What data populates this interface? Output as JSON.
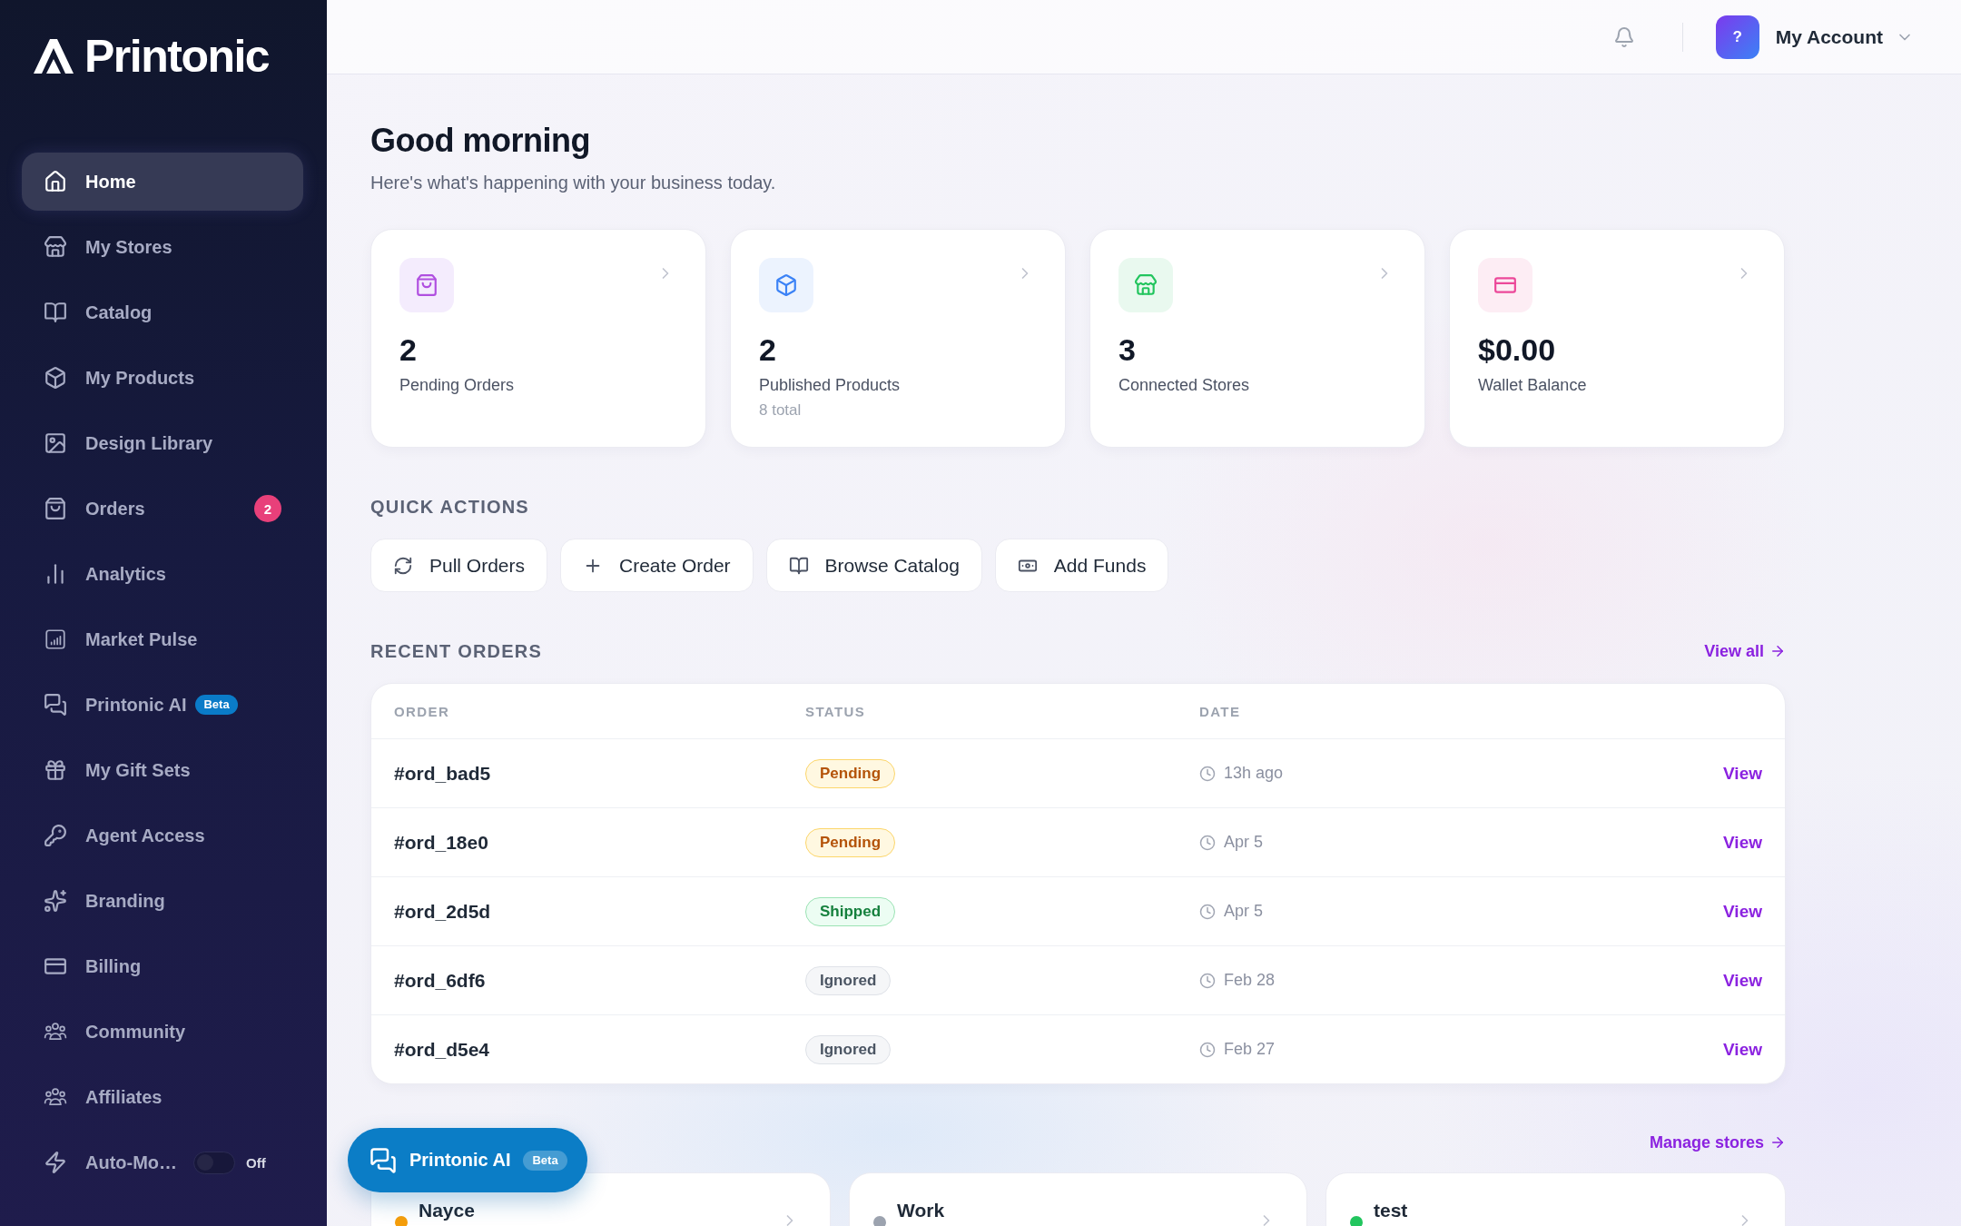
{
  "sidebar": {
    "logo": "Printonic",
    "items": [
      {
        "label": "Home",
        "selected": true
      },
      {
        "label": "My Stores",
        "selected": false
      },
      {
        "label": "Catalog",
        "selected": false
      },
      {
        "label": "My Products",
        "selected": false
      },
      {
        "label": "Design Library",
        "selected": false
      },
      {
        "label": "Orders",
        "selected": false,
        "badge": "2"
      },
      {
        "label": "Analytics",
        "selected": false
      },
      {
        "label": "Market Pulse",
        "selected": false
      },
      {
        "label": "Printonic AI",
        "selected": false,
        "tag": "Beta"
      },
      {
        "label": "My Gift Sets",
        "selected": false
      },
      {
        "label": "Agent Access",
        "selected": false
      },
      {
        "label": "Branding",
        "selected": false
      },
      {
        "label": "Billing",
        "selected": false
      },
      {
        "label": "Community",
        "selected": false
      },
      {
        "label": "Affiliates",
        "selected": false
      },
      {
        "label": "Auto-Mo…",
        "selected": false,
        "toggle": {
          "on": false,
          "label": "Off"
        }
      }
    ]
  },
  "top_bar": {
    "account": {
      "avatar": "?",
      "label": "My Account"
    }
  },
  "greeting": {
    "title": "Good morning",
    "subtitle": "Here's what's happening with your business today."
  },
  "stats": [
    {
      "value": "2",
      "label": "Pending Orders"
    },
    {
      "value": "2",
      "label": "Published Products",
      "note": "8 total"
    },
    {
      "value": "3",
      "label": "Connected Stores"
    },
    {
      "value": "$0.00",
      "label": "Wallet Balance"
    }
  ],
  "quick_actions": {
    "title": "QUICK ACTIONS",
    "buttons": [
      "Pull Orders",
      "Create Order",
      "Browse Catalog",
      "Add Funds"
    ]
  },
  "recent_orders": {
    "title": "RECENT ORDERS",
    "link": "View all",
    "columns": [
      "ORDER",
      "STATUS",
      "DATE"
    ],
    "rows": [
      {
        "order": "#ord_bad5",
        "status": {
          "label": "Pending",
          "kind": "pending"
        },
        "date": "13h ago",
        "action": "View"
      },
      {
        "order": "#ord_18e0",
        "status": {
          "label": "Pending",
          "kind": "pending"
        },
        "date": "Apr 5",
        "action": "View"
      },
      {
        "order": "#ord_2d5d",
        "status": {
          "label": "Shipped",
          "kind": "shipped"
        },
        "date": "Apr 5",
        "action": "View"
      },
      {
        "order": "#ord_6df6",
        "status": {
          "label": "Ignored",
          "kind": "ignored"
        },
        "date": "Feb 28",
        "action": "View"
      },
      {
        "order": "#ord_d5e4",
        "status": {
          "label": "Ignored",
          "kind": "ignored"
        },
        "date": "Feb 27",
        "action": "View"
      }
    ]
  },
  "stores": {
    "link": "Manage stores",
    "items": [
      {
        "name": "Nayce",
        "color": "#f59e0b"
      },
      {
        "name": "Work",
        "color": "#9ca3af"
      },
      {
        "name": "test",
        "color": "#22c55e"
      }
    ]
  },
  "assistant_button": {
    "label": "Printonic AI",
    "tag": "Beta"
  }
}
